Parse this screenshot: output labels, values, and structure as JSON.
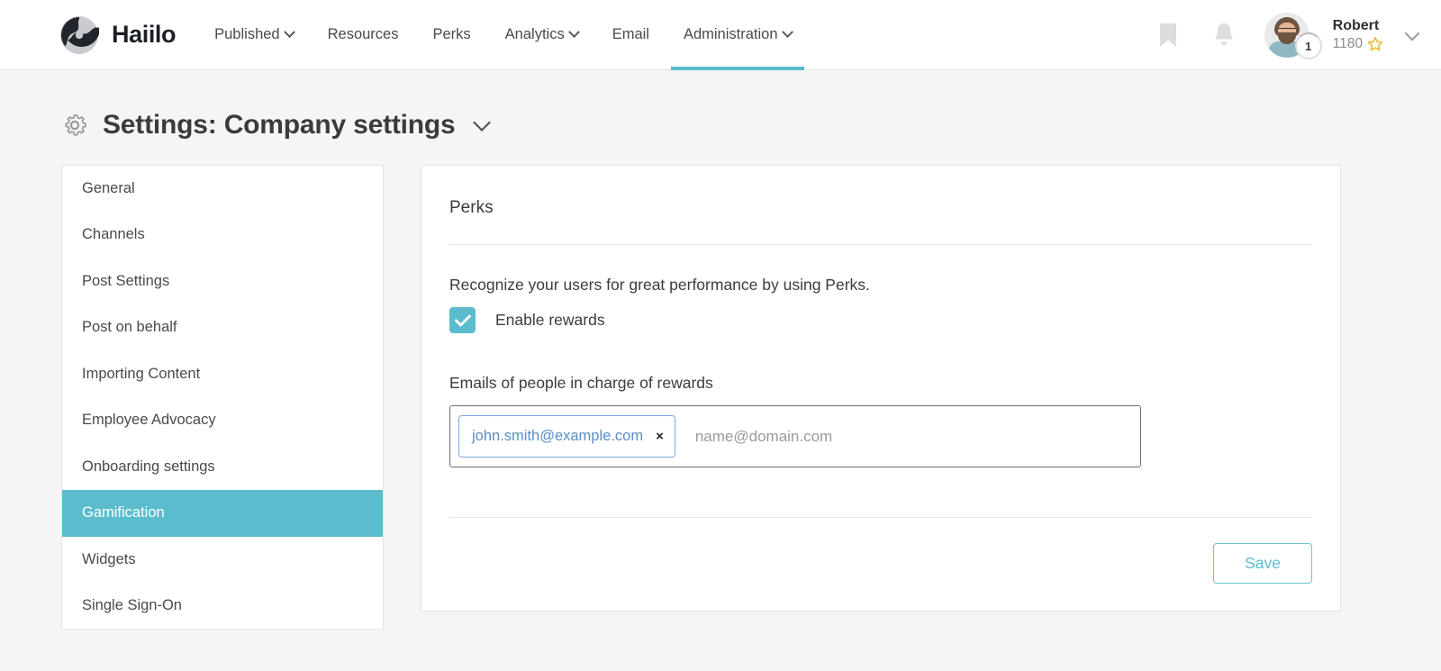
{
  "brand": {
    "name": "Haiilo",
    "logo_icon": "haiilo-logo-icon"
  },
  "nav": {
    "items": [
      {
        "label": "Published",
        "has_caret": true,
        "active": false
      },
      {
        "label": "Resources",
        "has_caret": false,
        "active": false
      },
      {
        "label": "Perks",
        "has_caret": false,
        "active": false
      },
      {
        "label": "Analytics",
        "has_caret": true,
        "active": false
      },
      {
        "label": "Email",
        "has_caret": false,
        "active": false
      },
      {
        "label": "Administration",
        "has_caret": true,
        "active": true
      }
    ]
  },
  "header_right": {
    "bookmark_icon": "bookmark-icon",
    "bell_icon": "bell-icon",
    "user_name": "Robert",
    "user_points": "1180",
    "star_icon": "star-icon",
    "level_badge": "1",
    "caret_icon": "chevron-down-icon"
  },
  "page": {
    "gear_icon": "gear-icon",
    "title_prefix": "Settings:",
    "title_value": "Company settings",
    "caret_icon": "chevron-down-icon"
  },
  "sidebar": {
    "items": [
      {
        "label": "General",
        "active": false
      },
      {
        "label": "Channels",
        "active": false
      },
      {
        "label": "Post Settings",
        "active": false
      },
      {
        "label": "Post on behalf",
        "active": false
      },
      {
        "label": "Importing Content",
        "active": false
      },
      {
        "label": "Employee Advocacy",
        "active": false
      },
      {
        "label": "Onboarding settings",
        "active": false
      },
      {
        "label": "Gamification",
        "active": true
      },
      {
        "label": "Widgets",
        "active": false
      },
      {
        "label": "Single Sign-On",
        "active": false
      }
    ]
  },
  "panel": {
    "title": "Perks",
    "lead": "Recognize your users for great performance by using Perks.",
    "checkbox_label": "Enable rewards",
    "checkbox_checked": true,
    "field_label": "Emails of people in charge of rewards",
    "chips": [
      {
        "text": "john.smith@example.com",
        "remove_icon": "close-icon",
        "remove_label": "×"
      }
    ],
    "input_placeholder": "name@domain.com",
    "save_label": "Save"
  },
  "colors": {
    "accent_teal": "#5bbcce",
    "chip_blue": "#5b8cc9",
    "page_bg": "#f5f5f5",
    "star_gold": "#f0b323"
  }
}
